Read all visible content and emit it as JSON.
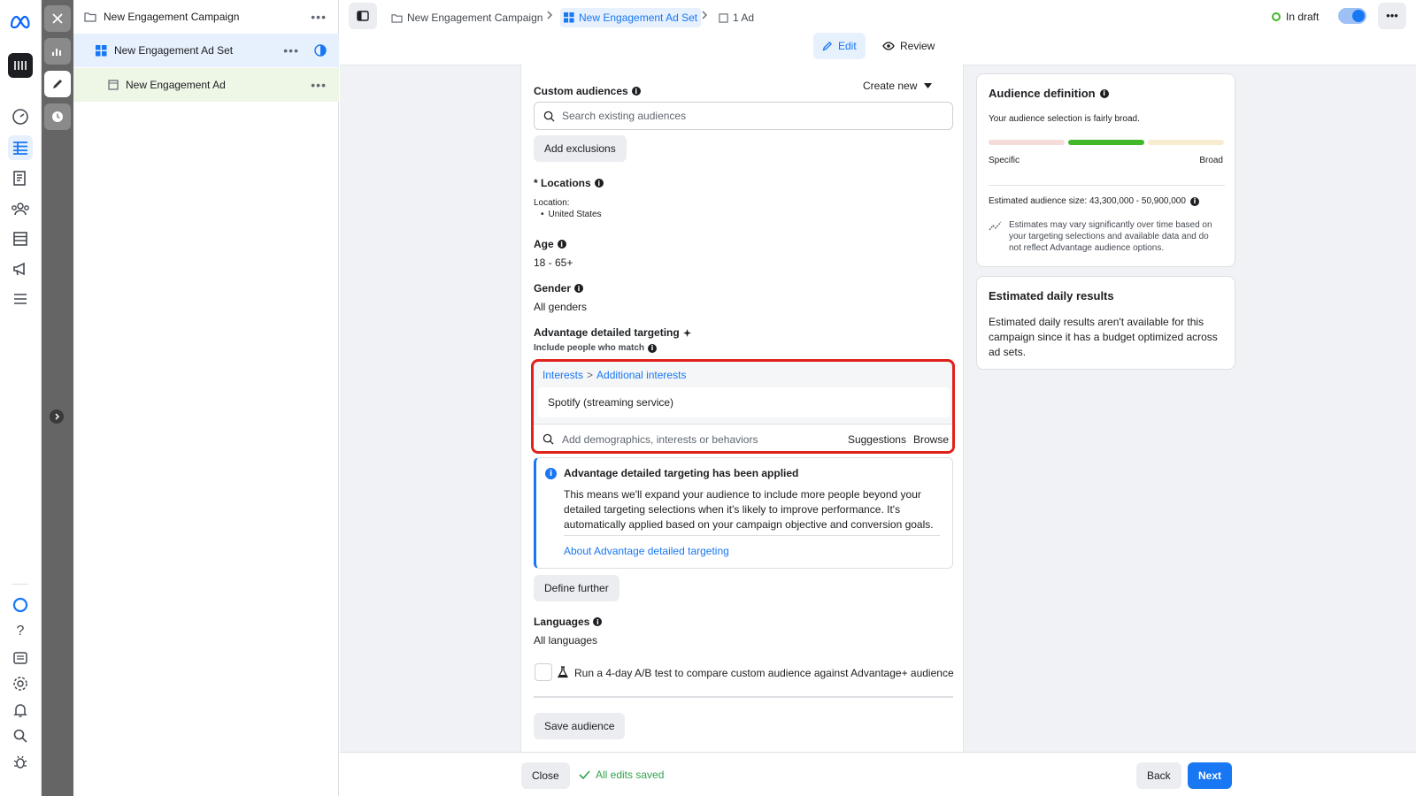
{
  "rail": {
    "items": [
      "meta-logo",
      "app-icon",
      "dashboard-icon",
      "table-icon",
      "pages-icon",
      "audiences-icon",
      "catalog-icon",
      "megaphone-icon",
      "menu-icon",
      "meta-ai-icon",
      "help-icon",
      "news-icon",
      "settings-icon",
      "notifications-icon",
      "search-icon",
      "bug-icon"
    ]
  },
  "tree": {
    "campaign": "New Engagement Campaign",
    "adset": "New Engagement Ad Set",
    "ad": "New Engagement Ad",
    "more": "•••"
  },
  "topbar": {
    "crumb_campaign": "New Engagement Campaign",
    "crumb_adset": "New Engagement Ad Set",
    "crumb_ad": "1 Ad",
    "status": "In draft",
    "more": "•••"
  },
  "tabs": {
    "edit": "Edit",
    "review": "Review"
  },
  "form": {
    "custom_audiences_label": "Custom audiences",
    "create_new": "Create new",
    "search_placeholder": "Search existing audiences",
    "add_exclusions": "Add exclusions",
    "locations_label": "* Locations",
    "location_caption": "Location:",
    "location_value": "United States",
    "age_label": "Age",
    "age_value": "18 - 65+",
    "gender_label": "Gender",
    "gender_value": "All genders",
    "adv_label": "Advantage detailed targeting",
    "include_label": "Include people who match",
    "interests_crumb_1": "Interests",
    "interests_sep": ">",
    "interests_crumb_2": "Additional interests",
    "interest_item": "Spotify (streaming service)",
    "add_placeholder": "Add demographics, interests or behaviors",
    "suggestions": "Suggestions",
    "browse": "Browse",
    "notice_title": "Advantage detailed targeting has been applied",
    "notice_body": "This means we'll expand your audience to include more people beyond your detailed targeting selections when it's likely to improve performance. It's automatically applied based on your campaign objective and conversion goals.",
    "notice_link": "About Advantage detailed targeting",
    "define_further": "Define further",
    "languages_label": "Languages",
    "languages_value": "All languages",
    "ab_test": "Run a 4-day A/B test to compare custom audience against Advantage+ audience",
    "save_audience": "Save audience"
  },
  "audience_def": {
    "title": "Audience definition",
    "subtitle": "Your audience selection is fairly broad.",
    "specific": "Specific",
    "broad": "Broad",
    "meter_colors": [
      "#f5dcd8",
      "#42b72a",
      "#f7ecd0"
    ],
    "size_label": "Estimated audience size: 43,300,000 - 50,900,000",
    "note": "Estimates may vary significantly over time based on your targeting selections and available data and do not reflect Advantage audience options."
  },
  "daily": {
    "title": "Estimated daily results",
    "body": "Estimated daily results aren't available for this campaign since it has a budget optimized across ad sets."
  },
  "footer": {
    "close": "Close",
    "saved": "All edits saved",
    "back": "Back",
    "next": "Next"
  },
  "colors": {
    "accent": "#1877f2",
    "highlight_border": "#e0211b",
    "success": "#31a24c"
  }
}
